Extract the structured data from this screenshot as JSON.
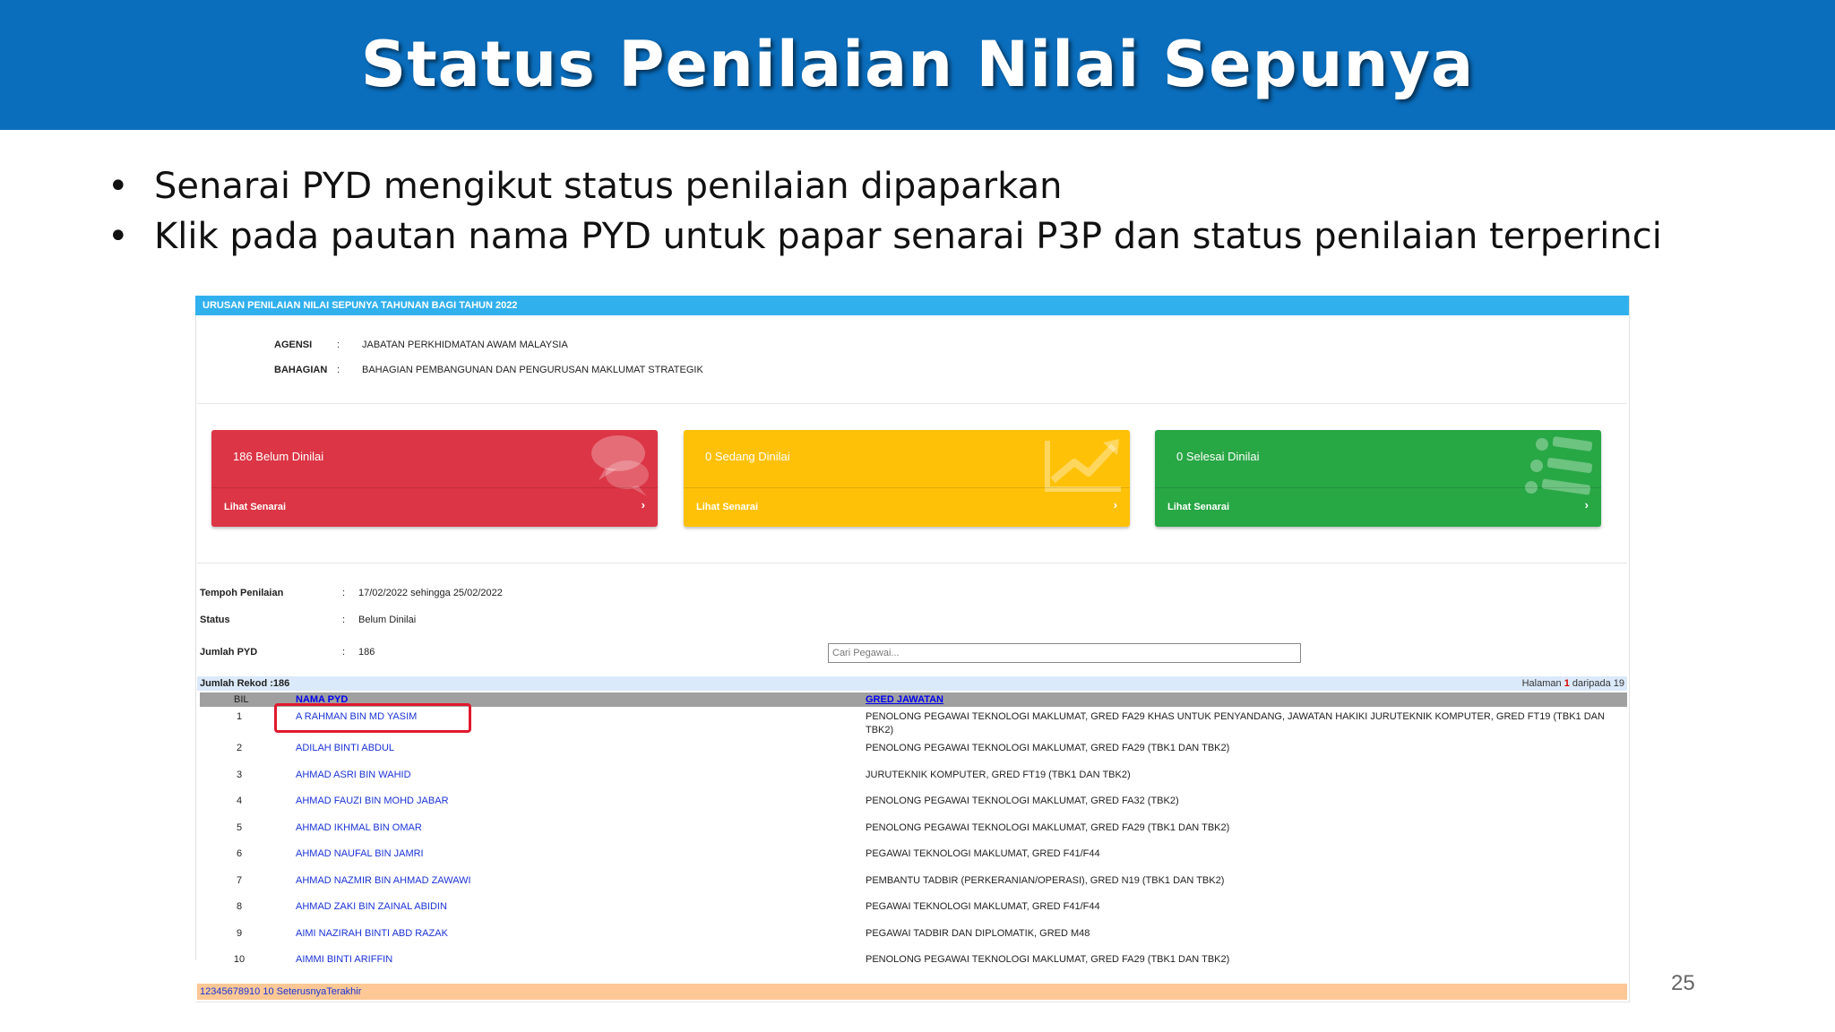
{
  "slide": {
    "title": "Status Penilaian Nilai Sepunya",
    "bullets": [
      "Senarai PYD mengikut status penilaian dipaparkan",
      "Klik pada pautan nama PYD untuk papar senarai P3P dan status penilaian terperinci"
    ],
    "page_number": "25"
  },
  "app": {
    "header": "URUSAN PENILAIAN NILAI SEPUNYA TAHUNAN BAGI TAHUN 2022",
    "agency_label": "AGENSI",
    "agency_value": "JABATAN PERKHIDMATAN AWAM MALAYSIA",
    "division_label": "BAHAGIAN",
    "division_value": "BAHAGIAN PEMBANGUNAN DAN PENGURUSAN MAKLUMAT STRATEGIK",
    "colon": ":",
    "cards": [
      {
        "count": "186 Belum Dinilai",
        "link": "Lihat Senarai",
        "color": "#dc3545",
        "icon": "comments-icon"
      },
      {
        "count": "0 Sedang Dinilai",
        "link": "Lihat Senarai",
        "color": "#ffc107",
        "icon": "chart-line-icon"
      },
      {
        "count": "0 Selesai Dinilai",
        "link": "Lihat Senarai",
        "color": "#28a745",
        "icon": "list-icon"
      }
    ],
    "chevron": "›",
    "tempoh_label": "Tempoh Penilaian",
    "tempoh_value": "17/02/2022 sehingga 25/02/2022",
    "status_label": "Status",
    "status_value": "Belum Dinilai",
    "jumlah_label": "Jumlah PYD",
    "jumlah_value": "186",
    "search_placeholder": "Cari Pegawai...",
    "jumlah_rekod": "Jumlah Rekod :186",
    "halaman_prefix": "Halaman",
    "halaman_current": "1",
    "halaman_suffix": "daripada 19",
    "columns": {
      "bil": "BIL",
      "nama": "NAMA PYD",
      "gred": "GRED JAWATAN"
    },
    "rows": [
      {
        "bil": "1",
        "nama": "A RAHMAN BIN MD YASIM",
        "gred": "PENOLONG PEGAWAI TEKNOLOGI MAKLUMAT, GRED FA29 KHAS UNTUK PENYANDANG, JAWATAN HAKIKI JURUTEKNIK KOMPUTER, GRED FT19 (TBK1 DAN TBK2)"
      },
      {
        "bil": "2",
        "nama": "ADILAH BINTI ABDUL",
        "gred": "PENOLONG PEGAWAI TEKNOLOGI MAKLUMAT, GRED FA29 (TBK1 DAN TBK2)"
      },
      {
        "bil": "3",
        "nama": "AHMAD ASRI BIN WAHID",
        "gred": "JURUTEKNIK KOMPUTER, GRED FT19 (TBK1 DAN TBK2)"
      },
      {
        "bil": "4",
        "nama": "AHMAD FAUZI BIN MOHD JABAR",
        "gred": "PENOLONG PEGAWAI TEKNOLOGI MAKLUMAT, GRED FA32 (TBK2)"
      },
      {
        "bil": "5",
        "nama": "AHMAD IKHMAL BIN OMAR",
        "gred": "PENOLONG PEGAWAI TEKNOLOGI MAKLUMAT, GRED FA29 (TBK1 DAN TBK2)"
      },
      {
        "bil": "6",
        "nama": "AHMAD NAUFAL BIN JAMRI",
        "gred": "PEGAWAI TEKNOLOGI MAKLUMAT, GRED F41/F44"
      },
      {
        "bil": "7",
        "nama": "AHMAD NAZMIR BIN AHMAD ZAWAWI",
        "gred": "PEMBANTU TADBIR (PERKERANIAN/OPERASI), GRED N19 (TBK1 DAN TBK2)"
      },
      {
        "bil": "8",
        "nama": "AHMAD ZAKI BIN ZAINAL ABIDIN",
        "gred": "PEGAWAI TEKNOLOGI MAKLUMAT, GRED F41/F44"
      },
      {
        "bil": "9",
        "nama": "AIMI NAZIRAH BINTI ABD RAZAK",
        "gred": "PEGAWAI TADBIR DAN DIPLOMATIK, GRED M48"
      },
      {
        "bil": "10",
        "nama": "AIMMI BINTI ARIFFIN",
        "gred": "PENOLONG PEGAWAI TEKNOLOGI MAKLUMAT, GRED FA29 (TBK1 DAN TBK2)"
      }
    ],
    "pagination": "12345678910 10 SeterusnyaTerakhir"
  }
}
